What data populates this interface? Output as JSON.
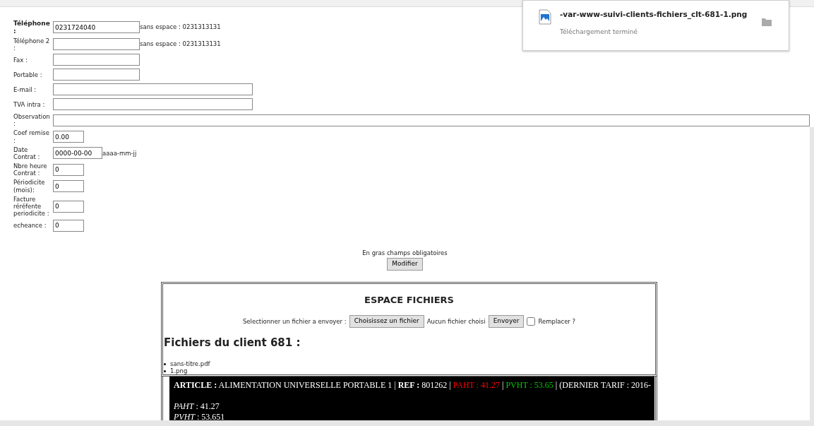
{
  "form": {
    "fields": [
      {
        "label": "Téléphone :",
        "required": true,
        "value": "0231724040",
        "kind": "short",
        "hint": "sans espace : 0231313131"
      },
      {
        "label": "Téléphone 2 :",
        "required": false,
        "kind": "short",
        "hint": "sans espace : 0231313131"
      },
      {
        "label": "Fax :",
        "required": false,
        "kind": "short"
      },
      {
        "label": "Portable :",
        "required": false,
        "kind": "short"
      },
      {
        "label": "E-mail :",
        "required": false,
        "kind": "long"
      },
      {
        "label": "TVA intra :",
        "required": false,
        "kind": "long"
      },
      {
        "label": "Observation :",
        "required": false,
        "kind": "full"
      },
      {
        "label": "Coef remise :",
        "required": false,
        "value": "0.00",
        "kind": "tiny"
      },
      {
        "label": "Date Contrat :",
        "required": false,
        "value": "0000-00-00",
        "kind": "date",
        "hint": "aaaa-mm-jj"
      },
      {
        "label": "Nbre heure Contrat :",
        "required": false,
        "value": "0",
        "kind": "tiny"
      },
      {
        "label": "Périodicite (mois):",
        "required": false,
        "value": "0",
        "kind": "tiny"
      },
      {
        "label": "Facture réréfente periodicite :",
        "required": false,
        "value": "0",
        "kind": "tiny"
      },
      {
        "label": "echeance :",
        "required": false,
        "value": "0",
        "kind": "tiny"
      }
    ],
    "note": "En gras champs obligatoires",
    "submit": "Modifier"
  },
  "files": {
    "title": "ESPACE FICHIERS",
    "upload_label": "Selectionner un fichier a envoyer :",
    "choose_button": "Choisissez un fichier",
    "no_file": "Aucun fichier choisi",
    "send_button": "Envoyer",
    "replace": {
      "label": "Remplacer ?",
      "checked": false
    },
    "heading": "Fichiers du client 681 :",
    "items": [
      "sans-titre.pdf",
      "1.png"
    ]
  },
  "article": {
    "segments": [
      {
        "text": "**ARTICLE :** ALIMENTATION UNIVERSELLE PORTABLE 1 | **REF :** 801262 | "
      },
      {
        "text": "PAHT : 41.27",
        "color": "#ff0000"
      },
      {
        "text": " | "
      },
      {
        "text": "PVHT : 53.65",
        "color": "#00cc00"
      },
      {
        "text": " | (DERNIER TARIF : 2016-"
      }
    ],
    "lines": [
      "*PAHT* : 41.27",
      "*PVHT* : 53.651"
    ]
  },
  "download": {
    "filename": "-var-www-suivi-clients-fichiers_clt-681-1.png",
    "status": "Téléchargement terminé"
  }
}
